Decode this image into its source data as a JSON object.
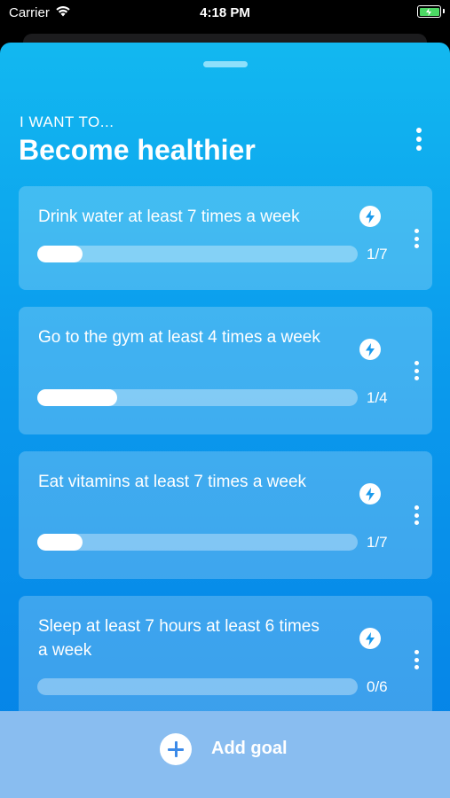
{
  "status_bar": {
    "carrier": "Carrier",
    "time": "4:18 PM"
  },
  "header": {
    "eyebrow": "I WANT TO...",
    "title": "Become healthier"
  },
  "goals": [
    {
      "text": "Drink water at least 7 times a week",
      "progress_label": "1/7",
      "progress": 0.142
    },
    {
      "text": "Go to the gym at least 4 times a week",
      "progress_label": "1/4",
      "progress": 0.25
    },
    {
      "text": "Eat vitamins at least 7 times a week",
      "progress_label": "1/7",
      "progress": 0.142
    },
    {
      "text": "Sleep at least 7 hours at least 6 times a week",
      "progress_label": "0/6",
      "progress": 0
    }
  ],
  "bottom": {
    "add_label": "Add goal"
  },
  "colors": {
    "sheet_top": "#12b8f0",
    "sheet_bottom": "#0480e6",
    "bottom_bar": "#89bdf0",
    "icon_blue": "#3c8ae8"
  }
}
